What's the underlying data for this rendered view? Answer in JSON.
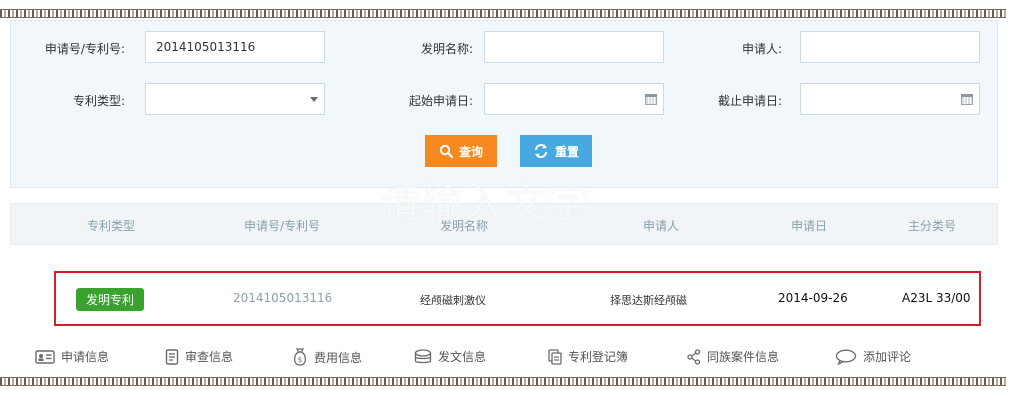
{
  "search_form": {
    "app_no_label": "申请号/专利号:",
    "app_no_value": "2014105013116",
    "invention_name_label": "发明名称:",
    "invention_name_value": "",
    "applicant_label": "申请人:",
    "applicant_value": "",
    "patent_type_label": "专利类型:",
    "patent_type_value": "",
    "start_date_label": "起始申请日:",
    "start_date_value": "",
    "end_date_label": "截止申请日:",
    "end_date_value": "",
    "search_button": "查询",
    "reset_button": "重置"
  },
  "watermark": "请输入文字",
  "table": {
    "headers": [
      "专利类型",
      "申请号/专利号",
      "发明名称",
      "申请人",
      "申请日",
      "主分类号"
    ],
    "rows": [
      {
        "patent_type": "发明专利",
        "app_no": "2014105013116",
        "name": "经颅磁刺激仪",
        "applicant": "择思达斯经颅磁",
        "app_date": "2014-09-26",
        "main_class": "A23L 33/00"
      }
    ]
  },
  "actions": [
    {
      "label": "申请信息",
      "icon": "id-card-icon"
    },
    {
      "label": "审查信息",
      "icon": "document-icon"
    },
    {
      "label": "费用信息",
      "icon": "money-bag-icon"
    },
    {
      "label": "发文信息",
      "icon": "coin-stack-icon"
    },
    {
      "label": "专利登记簿",
      "icon": "register-book-icon"
    },
    {
      "label": "同族案件信息",
      "icon": "share-icon"
    },
    {
      "label": "添加评论",
      "icon": "comment-icon"
    }
  ],
  "colors": {
    "search_button": "#f5891f",
    "reset_button": "#48a9e0",
    "badge": "#3aa32f",
    "highlight_border": "#d41f26",
    "header_text": "#8aa1ad"
  }
}
